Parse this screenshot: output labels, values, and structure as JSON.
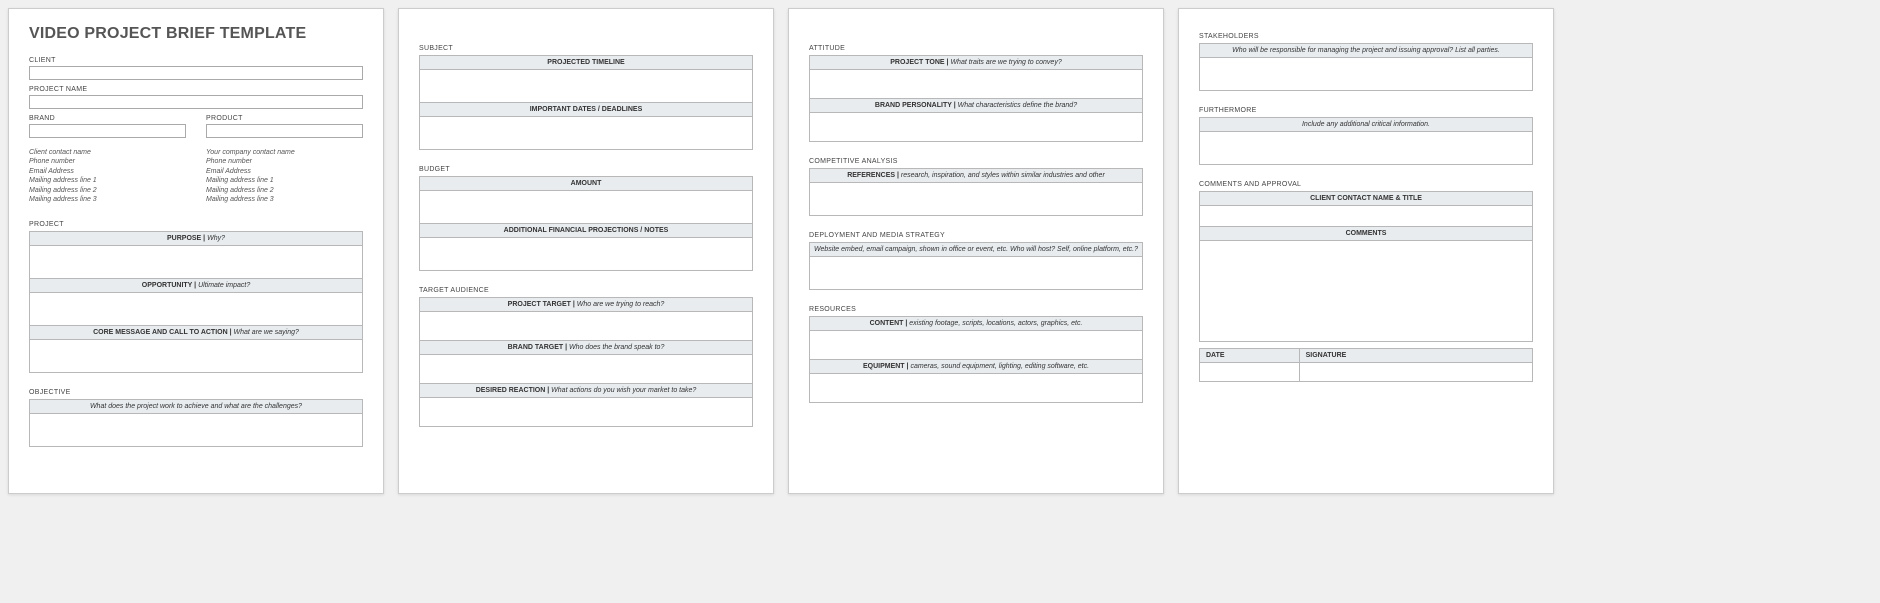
{
  "doc": {
    "title": "VIDEO PROJECT BRIEF TEMPLATE"
  },
  "fields": {
    "client": "CLIENT",
    "project_name": "PROJECT NAME",
    "brand": "BRAND",
    "product": "PRODUCT"
  },
  "client_contact": {
    "name": "Client contact name",
    "phone": "Phone number",
    "email": "Email Address",
    "addr1": "Mailing address line 1",
    "addr2": "Mailing address line 2",
    "addr3": "Mailing address line 3"
  },
  "company_contact": {
    "name": "Your company contact name",
    "phone": "Phone number",
    "email": "Email Address",
    "addr1": "Mailing address line 1",
    "addr2": "Mailing address line 2",
    "addr3": "Mailing address line 3"
  },
  "sections": {
    "project": "PROJECT",
    "objective": "OBJECTIVE",
    "subject": "SUBJECT",
    "budget": "BUDGET",
    "target_audience": "TARGET AUDIENCE",
    "attitude": "ATTITUDE",
    "competitive": "COMPETITIVE ANALYSIS",
    "deployment": "DEPLOYMENT AND MEDIA STRATEGY",
    "resources": "RESOURCES",
    "stakeholders": "STAKEHOLDERS",
    "furthermore": "FURTHERMORE",
    "comments": "COMMENTS AND APPROVAL"
  },
  "headers": {
    "purpose": {
      "label": "PURPOSE",
      "hint": "Why?"
    },
    "opportunity": {
      "label": "OPPORTUNITY",
      "hint": "Ultimate impact?"
    },
    "core_message": {
      "label": "CORE MESSAGE AND CALL TO ACTION",
      "hint": "What are we saying?"
    },
    "objective_hint": "What does the project work to achieve and what are the challenges?",
    "projected_timeline": "PROJECTED TIMELINE",
    "important_dates": "IMPORTANT DATES / DEADLINES",
    "amount": "AMOUNT",
    "financial_notes": "ADDITIONAL FINANCIAL PROJECTIONS / NOTES",
    "project_target": {
      "label": "PROJECT TARGET",
      "hint": "Who are we trying to reach?"
    },
    "brand_target": {
      "label": "BRAND TARGET",
      "hint": "Who does the brand speak to?"
    },
    "desired_reaction": {
      "label": "DESIRED REACTION",
      "hint": "What actions do you wish your market to take?"
    },
    "project_tone": {
      "label": "PROJECT TONE",
      "hint": "What traits are we trying to convey?"
    },
    "brand_personality": {
      "label": "BRAND PERSONALITY",
      "hint": "What characteristics define the brand?"
    },
    "references": {
      "label": "REFERENCES",
      "hint": "research, inspiration, and styles within similar industries and other"
    },
    "deployment_hint": "Website embed, email campaign, shown in office or event, etc.  Who will host? Self, online platform, etc.?",
    "content": {
      "label": "CONTENT",
      "hint": "existing footage, scripts, locations, actors, graphics, etc."
    },
    "equipment": {
      "label": "EQUIPMENT",
      "hint": "cameras, sound equipment, lighting, editing software, etc."
    },
    "stakeholders_hint": "Who will be responsible for managing the project and issuing approval? List all parties.",
    "furthermore_hint": "Include any additional critical information.",
    "client_contact_title": "CLIENT CONTACT NAME & TITLE",
    "comments_label": "COMMENTS",
    "date": "DATE",
    "signature": "SIGNATURE"
  },
  "sep": "   |   "
}
